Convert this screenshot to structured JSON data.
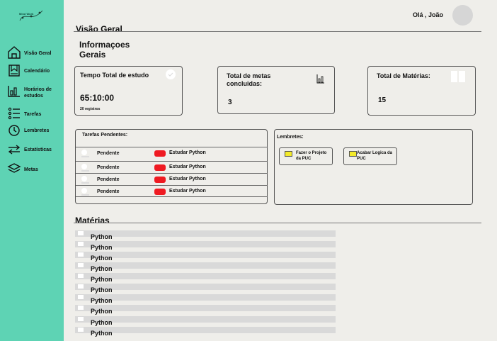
{
  "sidebar": {
    "logo_text": "Mind Work",
    "items": [
      {
        "label": "Visão Geral",
        "icon": "home-icon"
      },
      {
        "label": "Calendário",
        "icon": "calendar-icon"
      },
      {
        "label": "Horários de estudos",
        "icon": "schedule-chart-icon"
      },
      {
        "label": "Tarefas",
        "icon": "list-icon"
      },
      {
        "label": "Lembretes",
        "icon": "clock-icon"
      },
      {
        "label": "Estatísticas",
        "icon": "arrows-icon"
      },
      {
        "label": "Metas",
        "icon": "layers-icon"
      }
    ]
  },
  "header": {
    "greeting": "Olá , João"
  },
  "page_title": "Visão Geral",
  "info_section": {
    "title": "Informaçoes Gerais"
  },
  "cards": {
    "study_time": {
      "title": "Tempo  Total de estudo",
      "value": "65:10:00",
      "sub": "20 registros"
    },
    "goals": {
      "title": "Total de metas concluidas:",
      "value": "3"
    },
    "subjects": {
      "title": "Total de Matérias:",
      "value": "15"
    }
  },
  "pending_tasks": {
    "title": "Tarefas Pendentes:",
    "rows": [
      {
        "status": "Pendente",
        "task": "Estudar Python"
      },
      {
        "status": "Pendente",
        "task": "Estudar Python"
      },
      {
        "status": "Pendente",
        "task": "Estudar Python"
      },
      {
        "status": "Pendente",
        "task": "Estudar Python"
      }
    ]
  },
  "reminders": {
    "title": "Lembretes:",
    "items": [
      "Fazer o Projeto da PUC",
      "Acabar Logica da PUC"
    ]
  },
  "materias": {
    "title": "Matérias",
    "items": [
      "Python",
      "Python",
      "Python",
      "Python",
      "Python",
      "Python",
      "Python",
      "Python",
      "Python",
      "Python"
    ]
  },
  "colors": {
    "sidebar": "#5ed3b4",
    "background": "#efeeea",
    "task_tag": "#ef1a22",
    "note": "#f3ea2a"
  }
}
